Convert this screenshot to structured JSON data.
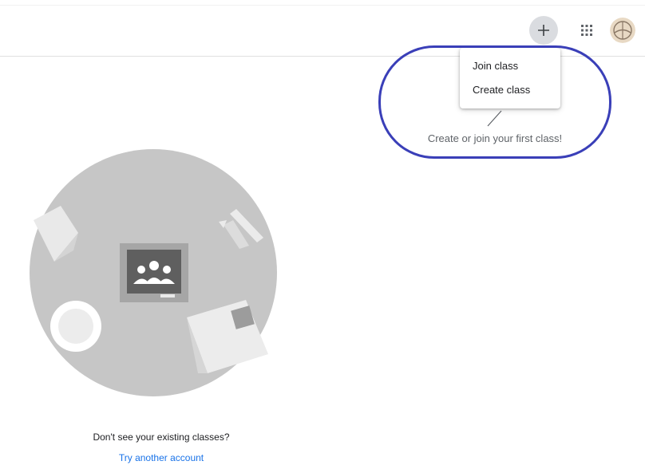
{
  "header": {
    "add_icon": "plus-icon",
    "apps_icon": "apps-grid-icon",
    "avatar_icon": "account-avatar"
  },
  "menu": {
    "items": [
      {
        "label": "Join class"
      },
      {
        "label": "Create class"
      }
    ]
  },
  "callout": {
    "text": "Create or join your first class!",
    "ring_color": "#3a3fb8"
  },
  "empty_state": {
    "illustration_icon": "classroom-illustration",
    "message": "Don't see your existing classes?",
    "link_label": "Try another account"
  },
  "colors": {
    "link": "#1a73e8",
    "illustration_gray": "#c6c6c6",
    "button_bg": "#dadce0"
  }
}
